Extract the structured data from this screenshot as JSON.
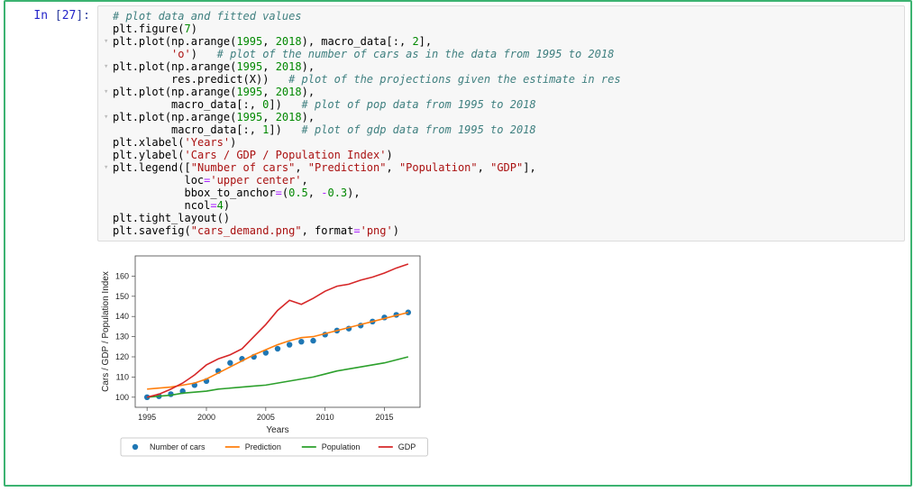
{
  "prompt": {
    "label": "In",
    "number": "27"
  },
  "code": [
    {
      "fold": "",
      "tokens": [
        {
          "c": "cm",
          "t": "# plot data and fitted values"
        }
      ]
    },
    {
      "fold": "",
      "tokens": [
        {
          "c": "nn",
          "t": "plt"
        },
        {
          "c": "p",
          "t": "."
        },
        {
          "c": "nn",
          "t": "figure"
        },
        {
          "c": "p",
          "t": "("
        },
        {
          "c": "mi",
          "t": "7"
        },
        {
          "c": "p",
          "t": ")"
        }
      ]
    },
    {
      "fold": "▾",
      "tokens": [
        {
          "c": "nn",
          "t": "plt"
        },
        {
          "c": "p",
          "t": "."
        },
        {
          "c": "nn",
          "t": "plot"
        },
        {
          "c": "p",
          "t": "(np"
        },
        {
          "c": "p",
          "t": "."
        },
        {
          "c": "nn",
          "t": "arange"
        },
        {
          "c": "p",
          "t": "("
        },
        {
          "c": "mi",
          "t": "1995"
        },
        {
          "c": "p",
          "t": ", "
        },
        {
          "c": "mi",
          "t": "2018"
        },
        {
          "c": "p",
          "t": "), macro_data[:, "
        },
        {
          "c": "mi",
          "t": "2"
        },
        {
          "c": "p",
          "t": "],"
        }
      ]
    },
    {
      "fold": "",
      "tokens": [
        {
          "c": "nn",
          "t": "         "
        },
        {
          "c": "s",
          "t": "'o'"
        },
        {
          "c": "p",
          "t": ")   "
        },
        {
          "c": "cm",
          "t": "# plot of the number of cars as in the data from 1995 to 2018"
        }
      ]
    },
    {
      "fold": "▾",
      "tokens": [
        {
          "c": "nn",
          "t": "plt"
        },
        {
          "c": "p",
          "t": "."
        },
        {
          "c": "nn",
          "t": "plot"
        },
        {
          "c": "p",
          "t": "(np"
        },
        {
          "c": "p",
          "t": "."
        },
        {
          "c": "nn",
          "t": "arange"
        },
        {
          "c": "p",
          "t": "("
        },
        {
          "c": "mi",
          "t": "1995"
        },
        {
          "c": "p",
          "t": ", "
        },
        {
          "c": "mi",
          "t": "2018"
        },
        {
          "c": "p",
          "t": "),"
        }
      ]
    },
    {
      "fold": "",
      "tokens": [
        {
          "c": "nn",
          "t": "         res"
        },
        {
          "c": "p",
          "t": "."
        },
        {
          "c": "nn",
          "t": "predict"
        },
        {
          "c": "p",
          "t": "(X))   "
        },
        {
          "c": "cm",
          "t": "# plot of the projections given the estimate in res"
        }
      ]
    },
    {
      "fold": "▾",
      "tokens": [
        {
          "c": "nn",
          "t": "plt"
        },
        {
          "c": "p",
          "t": "."
        },
        {
          "c": "nn",
          "t": "plot"
        },
        {
          "c": "p",
          "t": "(np"
        },
        {
          "c": "p",
          "t": "."
        },
        {
          "c": "nn",
          "t": "arange"
        },
        {
          "c": "p",
          "t": "("
        },
        {
          "c": "mi",
          "t": "1995"
        },
        {
          "c": "p",
          "t": ", "
        },
        {
          "c": "mi",
          "t": "2018"
        },
        {
          "c": "p",
          "t": "),"
        }
      ]
    },
    {
      "fold": "",
      "tokens": [
        {
          "c": "nn",
          "t": "         macro_data[:, "
        },
        {
          "c": "mi",
          "t": "0"
        },
        {
          "c": "p",
          "t": "])   "
        },
        {
          "c": "cm",
          "t": "# plot of pop data from 1995 to 2018"
        }
      ]
    },
    {
      "fold": "▾",
      "tokens": [
        {
          "c": "nn",
          "t": "plt"
        },
        {
          "c": "p",
          "t": "."
        },
        {
          "c": "nn",
          "t": "plot"
        },
        {
          "c": "p",
          "t": "(np"
        },
        {
          "c": "p",
          "t": "."
        },
        {
          "c": "nn",
          "t": "arange"
        },
        {
          "c": "p",
          "t": "("
        },
        {
          "c": "mi",
          "t": "1995"
        },
        {
          "c": "p",
          "t": ", "
        },
        {
          "c": "mi",
          "t": "2018"
        },
        {
          "c": "p",
          "t": "),"
        }
      ]
    },
    {
      "fold": "",
      "tokens": [
        {
          "c": "nn",
          "t": "         macro_data[:, "
        },
        {
          "c": "mi",
          "t": "1"
        },
        {
          "c": "p",
          "t": "])   "
        },
        {
          "c": "cm",
          "t": "# plot of gdp data from 1995 to 2018"
        }
      ]
    },
    {
      "fold": "",
      "tokens": [
        {
          "c": "nn",
          "t": "plt"
        },
        {
          "c": "p",
          "t": "."
        },
        {
          "c": "nn",
          "t": "xlabel"
        },
        {
          "c": "p",
          "t": "("
        },
        {
          "c": "s",
          "t": "'Years'"
        },
        {
          "c": "p",
          "t": ")"
        }
      ]
    },
    {
      "fold": "",
      "tokens": [
        {
          "c": "nn",
          "t": "plt"
        },
        {
          "c": "p",
          "t": "."
        },
        {
          "c": "nn",
          "t": "ylabel"
        },
        {
          "c": "p",
          "t": "("
        },
        {
          "c": "s",
          "t": "'Cars / GDP / Population Index'"
        },
        {
          "c": "p",
          "t": ")"
        }
      ]
    },
    {
      "fold": "▾",
      "tokens": [
        {
          "c": "nn",
          "t": "plt"
        },
        {
          "c": "p",
          "t": "."
        },
        {
          "c": "nn",
          "t": "legend"
        },
        {
          "c": "p",
          "t": "(["
        },
        {
          "c": "s",
          "t": "\"Number of cars\""
        },
        {
          "c": "p",
          "t": ", "
        },
        {
          "c": "s",
          "t": "\"Prediction\""
        },
        {
          "c": "p",
          "t": ", "
        },
        {
          "c": "s",
          "t": "\"Population\""
        },
        {
          "c": "p",
          "t": ", "
        },
        {
          "c": "s",
          "t": "\"GDP\""
        },
        {
          "c": "p",
          "t": "],"
        }
      ]
    },
    {
      "fold": "",
      "tokens": [
        {
          "c": "nn",
          "t": "           loc"
        },
        {
          "c": "o",
          "t": "="
        },
        {
          "c": "s",
          "t": "'upper center'"
        },
        {
          "c": "p",
          "t": ","
        }
      ]
    },
    {
      "fold": "",
      "tokens": [
        {
          "c": "nn",
          "t": "           bbox_to_anchor"
        },
        {
          "c": "o",
          "t": "="
        },
        {
          "c": "p",
          "t": "("
        },
        {
          "c": "mi",
          "t": "0.5"
        },
        {
          "c": "p",
          "t": ", "
        },
        {
          "c": "o",
          "t": "-"
        },
        {
          "c": "mi",
          "t": "0.3"
        },
        {
          "c": "p",
          "t": "),"
        }
      ]
    },
    {
      "fold": "",
      "tokens": [
        {
          "c": "nn",
          "t": "           ncol"
        },
        {
          "c": "o",
          "t": "="
        },
        {
          "c": "mi",
          "t": "4"
        },
        {
          "c": "p",
          "t": ")"
        }
      ]
    },
    {
      "fold": "",
      "tokens": [
        {
          "c": "nn",
          "t": "plt"
        },
        {
          "c": "p",
          "t": "."
        },
        {
          "c": "nn",
          "t": "tight_layout"
        },
        {
          "c": "p",
          "t": "()"
        }
      ]
    },
    {
      "fold": "",
      "tokens": [
        {
          "c": "nn",
          "t": "plt"
        },
        {
          "c": "p",
          "t": "."
        },
        {
          "c": "nn",
          "t": "savefig"
        },
        {
          "c": "p",
          "t": "("
        },
        {
          "c": "s",
          "t": "\"cars_demand.png\""
        },
        {
          "c": "p",
          "t": ", format"
        },
        {
          "c": "o",
          "t": "="
        },
        {
          "c": "s",
          "t": "'png'"
        },
        {
          "c": "p",
          "t": ")"
        }
      ]
    }
  ],
  "chart_data": {
    "type": "line",
    "title": "",
    "xlabel": "Years",
    "ylabel": "Cars / GDP / Population Index",
    "x": [
      1995,
      1996,
      1997,
      1998,
      1999,
      2000,
      2001,
      2002,
      2003,
      2004,
      2005,
      2006,
      2007,
      2008,
      2009,
      2010,
      2011,
      2012,
      2013,
      2014,
      2015,
      2016,
      2017
    ],
    "xticks": [
      1995,
      2000,
      2005,
      2010,
      2015
    ],
    "yticks": [
      100,
      110,
      120,
      130,
      140,
      150,
      160
    ],
    "xlim": [
      1994,
      2018
    ],
    "ylim": [
      95,
      170
    ],
    "series": [
      {
        "name": "Number of cars",
        "style": "markers",
        "color": "#1f77b4",
        "values": [
          100,
          100.5,
          101.5,
          103,
          106,
          108,
          113,
          117,
          119,
          120,
          122,
          124,
          126,
          127.5,
          128,
          131,
          133,
          134,
          135.5,
          137.5,
          139.5,
          140.8,
          142
        ]
      },
      {
        "name": "Prediction",
        "style": "line",
        "color": "#ff7f0e",
        "values": [
          104,
          104.5,
          105,
          106,
          107,
          109,
          112,
          115,
          118,
          121,
          123.5,
          126,
          128,
          129.5,
          130,
          131.5,
          133,
          134.5,
          136,
          137.5,
          139,
          140.5,
          142
        ]
      },
      {
        "name": "Population",
        "style": "line",
        "color": "#2ca02c",
        "values": [
          100,
          100.5,
          101,
          102,
          102.5,
          103,
          104,
          104.5,
          105,
          105.5,
          106,
          107,
          108,
          109,
          110,
          111.5,
          113,
          114,
          115,
          116,
          117,
          118.5,
          120
        ]
      },
      {
        "name": "GDP",
        "style": "line",
        "color": "#d62728",
        "values": [
          100,
          101.5,
          104,
          107,
          111,
          116,
          119,
          121,
          124,
          130,
          136,
          143,
          148,
          146,
          149,
          152.5,
          155,
          156,
          158,
          159.5,
          161.5,
          164,
          166
        ]
      }
    ],
    "legend": [
      "Number of cars",
      "Prediction",
      "Population",
      "GDP"
    ]
  }
}
